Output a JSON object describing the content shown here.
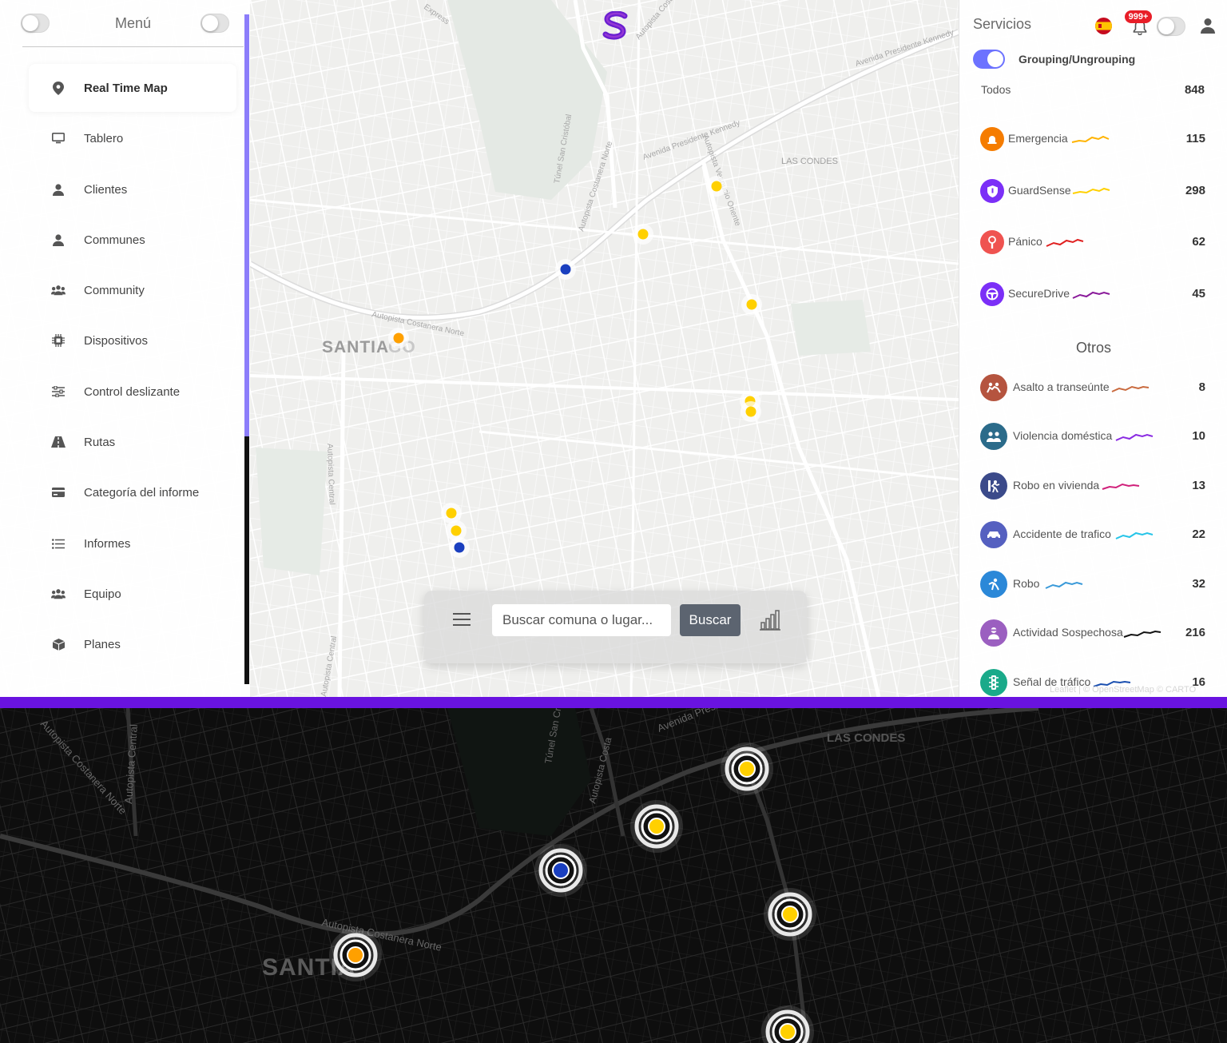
{
  "sidebar": {
    "title": "Menú",
    "items": [
      {
        "label": "Real Time Map",
        "icon": "map-pin-icon",
        "active": true
      },
      {
        "label": "Tablero",
        "icon": "monitor-icon"
      },
      {
        "label": "Clientes",
        "icon": "user-icon"
      },
      {
        "label": "Communes",
        "icon": "user-icon"
      },
      {
        "label": "Community",
        "icon": "users-icon"
      },
      {
        "label": "Dispositivos",
        "icon": "chip-icon"
      },
      {
        "label": "Control deslizante",
        "icon": "sliders-icon"
      },
      {
        "label": "Rutas",
        "icon": "road-icon"
      },
      {
        "label": "Categoría del informe",
        "icon": "card-icon"
      },
      {
        "label": "Informes",
        "icon": "list-icon"
      },
      {
        "label": "Equipo",
        "icon": "users-icon"
      },
      {
        "label": "Planes",
        "icon": "cube-icon"
      }
    ]
  },
  "map_labels": {
    "santiago": "SANTIAGO",
    "santiago_visible": "SANTIA",
    "santiago_tail": "GO",
    "las_condes": "LAS CONDES",
    "costanera_norte": "Autopista Costanera Norte",
    "costanera_norte_vertical": "Autopista Costanera Norte",
    "presidente_kennedy": "Avenida Presidente Kennedy",
    "presidente_kennedy_2": "Avenida Presidente Kennedy",
    "autopista_central": "Autopista Central",
    "autopista_central_2": "Autopista Central",
    "tunel_san_cristobal": "Túnel San Cristóbal",
    "costanera_sur": "Costanera Sur",
    "express": "Express",
    "vespucio_oriente": "Autopista Vespucio Oriente",
    "costanera_alt": "Autopista Costa"
  },
  "search": {
    "placeholder": "Buscar comuna o lugar...",
    "button": "Buscar"
  },
  "panel": {
    "title": "Servicios",
    "notification_badge": "999+",
    "group_label": "Grouping/Ungrouping",
    "all_label": "Todos",
    "all_count": "848",
    "others_title": "Otros",
    "services": [
      {
        "label": "Emergencia",
        "count": "115",
        "color": "#f57c00",
        "spark": "#ffb300",
        "icon": "siren-icon"
      },
      {
        "label": "GuardSense",
        "count": "298",
        "color": "#7b2ff7",
        "spark": "#ffd000",
        "icon": "shield-icon"
      },
      {
        "label": "Pánico",
        "count": "62",
        "color": "#ef5350",
        "spark": "#e02020",
        "icon": "panic-icon"
      },
      {
        "label": "SecureDrive",
        "count": "45",
        "color": "#7b2ff7",
        "spark": "#8a1a9a",
        "icon": "steering-wheel-icon"
      }
    ],
    "others": [
      {
        "label": "Asalto a transeúnte",
        "count": "8",
        "color": "#b5543f",
        "spark": "#c96a3e",
        "icon": "assault-icon"
      },
      {
        "label": "Violencia doméstica",
        "count": "10",
        "color": "#2b6b8a",
        "spark": "#8a2be2",
        "icon": "domestic-violence-icon"
      },
      {
        "label": "Robo en vivienda",
        "count": "13",
        "color": "#3b4a8a",
        "spark": "#d0207a",
        "icon": "burglary-icon"
      },
      {
        "label": "Accidente de trafico",
        "count": "22",
        "color": "#5560c0",
        "spark": "#25c4e8",
        "icon": "car-crash-icon"
      },
      {
        "label": "Robo",
        "count": "32",
        "color": "#2b88d8",
        "spark": "#3a9ad9",
        "icon": "robbery-icon"
      },
      {
        "label": "Actividad Sospechosa",
        "count": "216",
        "color": "#9b5fc0",
        "spark": "#111111",
        "icon": "suspicious-person-icon"
      },
      {
        "label": "Señal de tráfico",
        "count": "16",
        "color": "#1aaa8a",
        "spark": "#1a4fb0",
        "icon": "traffic-light-icon"
      }
    ],
    "attribution": "Leaflet | © OpenStreetMap © CARTO"
  },
  "markers": [
    {
      "name": "marker-yellow",
      "color": "#ffd000"
    },
    {
      "name": "marker-yellow",
      "color": "#ffd000"
    },
    {
      "name": "marker-blue",
      "color": "#1a3fbf"
    },
    {
      "name": "marker-yellow",
      "color": "#ffd000"
    },
    {
      "name": "marker-orange",
      "color": "#ffa000"
    },
    {
      "name": "marker-yellow",
      "color": "#ffd000"
    },
    {
      "name": "marker-yellow",
      "color": "#ffd000"
    },
    {
      "name": "marker-yellow",
      "color": "#ffd000"
    },
    {
      "name": "marker-yellow",
      "color": "#ffd000"
    },
    {
      "name": "marker-blue",
      "color": "#1a3fbf"
    }
  ],
  "dark_markers": [
    {
      "name": "marker-yellow",
      "color": "#ffd000"
    },
    {
      "name": "marker-yellow",
      "color": "#ffd000"
    },
    {
      "name": "marker-blue",
      "color": "#1a3fbf"
    },
    {
      "name": "marker-yellow",
      "color": "#ffd000"
    },
    {
      "name": "marker-orange",
      "color": "#ffa000"
    },
    {
      "name": "marker-yellow",
      "color": "#ffd000"
    }
  ],
  "colors": {
    "accent": "#6913e0",
    "switch": "#6c72ff",
    "scroll": "#8c7dfa"
  }
}
